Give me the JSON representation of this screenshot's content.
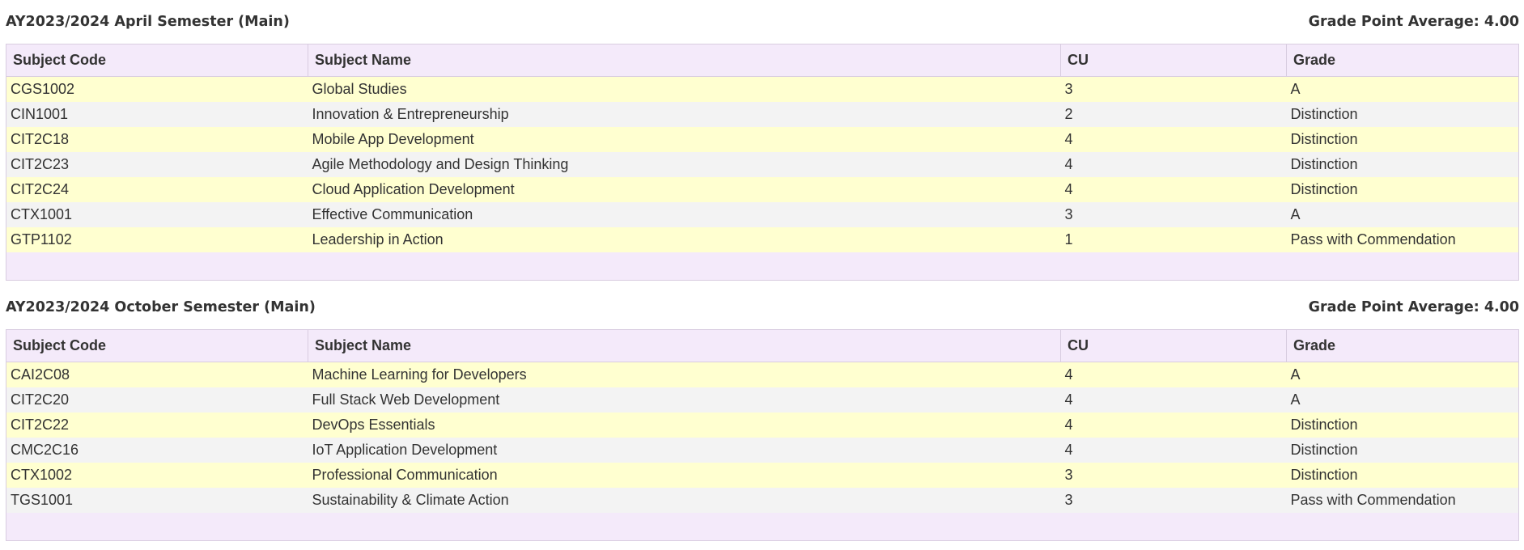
{
  "columns": {
    "code": "Subject Code",
    "name": "Subject Name",
    "cu": "CU",
    "grade": "Grade"
  },
  "semesters": [
    {
      "title": "AY2023/2024 April Semester (Main)",
      "gpa": "Grade Point Average: 4.00",
      "rows": [
        {
          "code": "CGS1002",
          "name": "Global Studies",
          "cu": "3",
          "grade": "A"
        },
        {
          "code": "CIN1001",
          "name": "Innovation & Entrepreneurship",
          "cu": "2",
          "grade": "Distinction"
        },
        {
          "code": "CIT2C18",
          "name": "Mobile App Development",
          "cu": "4",
          "grade": "Distinction"
        },
        {
          "code": "CIT2C23",
          "name": "Agile Methodology and Design Thinking",
          "cu": "4",
          "grade": "Distinction"
        },
        {
          "code": "CIT2C24",
          "name": "Cloud Application Development",
          "cu": "4",
          "grade": "Distinction"
        },
        {
          "code": "CTX1001",
          "name": "Effective Communication",
          "cu": "3",
          "grade": "A"
        },
        {
          "code": "GTP1102",
          "name": "Leadership in Action",
          "cu": "1",
          "grade": "Pass with Commendation"
        }
      ]
    },
    {
      "title": "AY2023/2024 October Semester (Main)",
      "gpa": "Grade Point Average: 4.00",
      "rows": [
        {
          "code": "CAI2C08",
          "name": "Machine Learning for Developers",
          "cu": "4",
          "grade": "A"
        },
        {
          "code": "CIT2C20",
          "name": "Full Stack Web Development",
          "cu": "4",
          "grade": "A"
        },
        {
          "code": "CIT2C22",
          "name": "DevOps Essentials",
          "cu": "4",
          "grade": "Distinction"
        },
        {
          "code": "CMC2C16",
          "name": "IoT Application Development",
          "cu": "4",
          "grade": "Distinction"
        },
        {
          "code": "CTX1002",
          "name": "Professional Communication",
          "cu": "3",
          "grade": "Distinction"
        },
        {
          "code": "TGS1001",
          "name": "Sustainability & Climate Action",
          "cu": "3",
          "grade": "Pass with Commendation"
        }
      ]
    }
  ]
}
